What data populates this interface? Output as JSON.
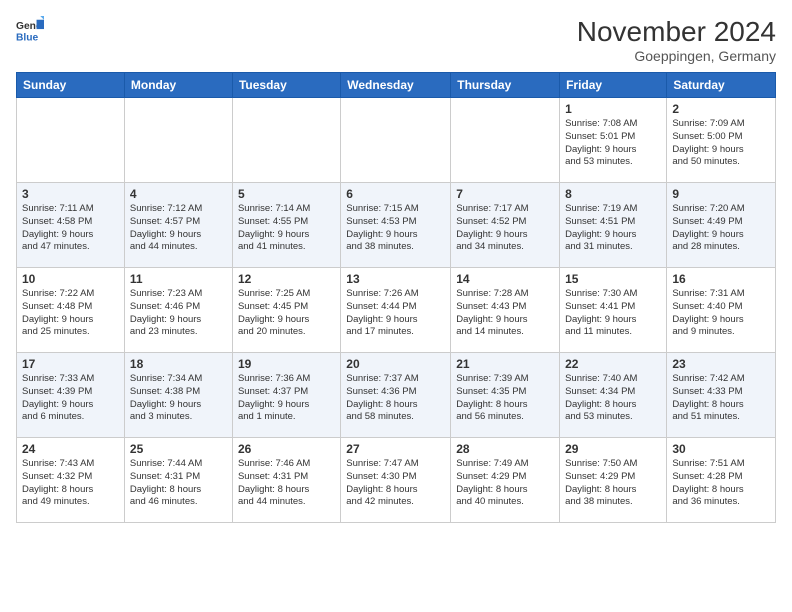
{
  "logo": {
    "general": "General",
    "blue": "Blue"
  },
  "title": "November 2024",
  "subtitle": "Goeppingen, Germany",
  "days_header": [
    "Sunday",
    "Monday",
    "Tuesday",
    "Wednesday",
    "Thursday",
    "Friday",
    "Saturday"
  ],
  "weeks": [
    [
      {
        "day": "",
        "info": ""
      },
      {
        "day": "",
        "info": ""
      },
      {
        "day": "",
        "info": ""
      },
      {
        "day": "",
        "info": ""
      },
      {
        "day": "",
        "info": ""
      },
      {
        "day": "1",
        "info": "Sunrise: 7:08 AM\nSunset: 5:01 PM\nDaylight: 9 hours\nand 53 minutes."
      },
      {
        "day": "2",
        "info": "Sunrise: 7:09 AM\nSunset: 5:00 PM\nDaylight: 9 hours\nand 50 minutes."
      }
    ],
    [
      {
        "day": "3",
        "info": "Sunrise: 7:11 AM\nSunset: 4:58 PM\nDaylight: 9 hours\nand 47 minutes."
      },
      {
        "day": "4",
        "info": "Sunrise: 7:12 AM\nSunset: 4:57 PM\nDaylight: 9 hours\nand 44 minutes."
      },
      {
        "day": "5",
        "info": "Sunrise: 7:14 AM\nSunset: 4:55 PM\nDaylight: 9 hours\nand 41 minutes."
      },
      {
        "day": "6",
        "info": "Sunrise: 7:15 AM\nSunset: 4:53 PM\nDaylight: 9 hours\nand 38 minutes."
      },
      {
        "day": "7",
        "info": "Sunrise: 7:17 AM\nSunset: 4:52 PM\nDaylight: 9 hours\nand 34 minutes."
      },
      {
        "day": "8",
        "info": "Sunrise: 7:19 AM\nSunset: 4:51 PM\nDaylight: 9 hours\nand 31 minutes."
      },
      {
        "day": "9",
        "info": "Sunrise: 7:20 AM\nSunset: 4:49 PM\nDaylight: 9 hours\nand 28 minutes."
      }
    ],
    [
      {
        "day": "10",
        "info": "Sunrise: 7:22 AM\nSunset: 4:48 PM\nDaylight: 9 hours\nand 25 minutes."
      },
      {
        "day": "11",
        "info": "Sunrise: 7:23 AM\nSunset: 4:46 PM\nDaylight: 9 hours\nand 23 minutes."
      },
      {
        "day": "12",
        "info": "Sunrise: 7:25 AM\nSunset: 4:45 PM\nDaylight: 9 hours\nand 20 minutes."
      },
      {
        "day": "13",
        "info": "Sunrise: 7:26 AM\nSunset: 4:44 PM\nDaylight: 9 hours\nand 17 minutes."
      },
      {
        "day": "14",
        "info": "Sunrise: 7:28 AM\nSunset: 4:43 PM\nDaylight: 9 hours\nand 14 minutes."
      },
      {
        "day": "15",
        "info": "Sunrise: 7:30 AM\nSunset: 4:41 PM\nDaylight: 9 hours\nand 11 minutes."
      },
      {
        "day": "16",
        "info": "Sunrise: 7:31 AM\nSunset: 4:40 PM\nDaylight: 9 hours\nand 9 minutes."
      }
    ],
    [
      {
        "day": "17",
        "info": "Sunrise: 7:33 AM\nSunset: 4:39 PM\nDaylight: 9 hours\nand 6 minutes."
      },
      {
        "day": "18",
        "info": "Sunrise: 7:34 AM\nSunset: 4:38 PM\nDaylight: 9 hours\nand 3 minutes."
      },
      {
        "day": "19",
        "info": "Sunrise: 7:36 AM\nSunset: 4:37 PM\nDaylight: 9 hours\nand 1 minute."
      },
      {
        "day": "20",
        "info": "Sunrise: 7:37 AM\nSunset: 4:36 PM\nDaylight: 8 hours\nand 58 minutes."
      },
      {
        "day": "21",
        "info": "Sunrise: 7:39 AM\nSunset: 4:35 PM\nDaylight: 8 hours\nand 56 minutes."
      },
      {
        "day": "22",
        "info": "Sunrise: 7:40 AM\nSunset: 4:34 PM\nDaylight: 8 hours\nand 53 minutes."
      },
      {
        "day": "23",
        "info": "Sunrise: 7:42 AM\nSunset: 4:33 PM\nDaylight: 8 hours\nand 51 minutes."
      }
    ],
    [
      {
        "day": "24",
        "info": "Sunrise: 7:43 AM\nSunset: 4:32 PM\nDaylight: 8 hours\nand 49 minutes."
      },
      {
        "day": "25",
        "info": "Sunrise: 7:44 AM\nSunset: 4:31 PM\nDaylight: 8 hours\nand 46 minutes."
      },
      {
        "day": "26",
        "info": "Sunrise: 7:46 AM\nSunset: 4:31 PM\nDaylight: 8 hours\nand 44 minutes."
      },
      {
        "day": "27",
        "info": "Sunrise: 7:47 AM\nSunset: 4:30 PM\nDaylight: 8 hours\nand 42 minutes."
      },
      {
        "day": "28",
        "info": "Sunrise: 7:49 AM\nSunset: 4:29 PM\nDaylight: 8 hours\nand 40 minutes."
      },
      {
        "day": "29",
        "info": "Sunrise: 7:50 AM\nSunset: 4:29 PM\nDaylight: 8 hours\nand 38 minutes."
      },
      {
        "day": "30",
        "info": "Sunrise: 7:51 AM\nSunset: 4:28 PM\nDaylight: 8 hours\nand 36 minutes."
      }
    ]
  ]
}
